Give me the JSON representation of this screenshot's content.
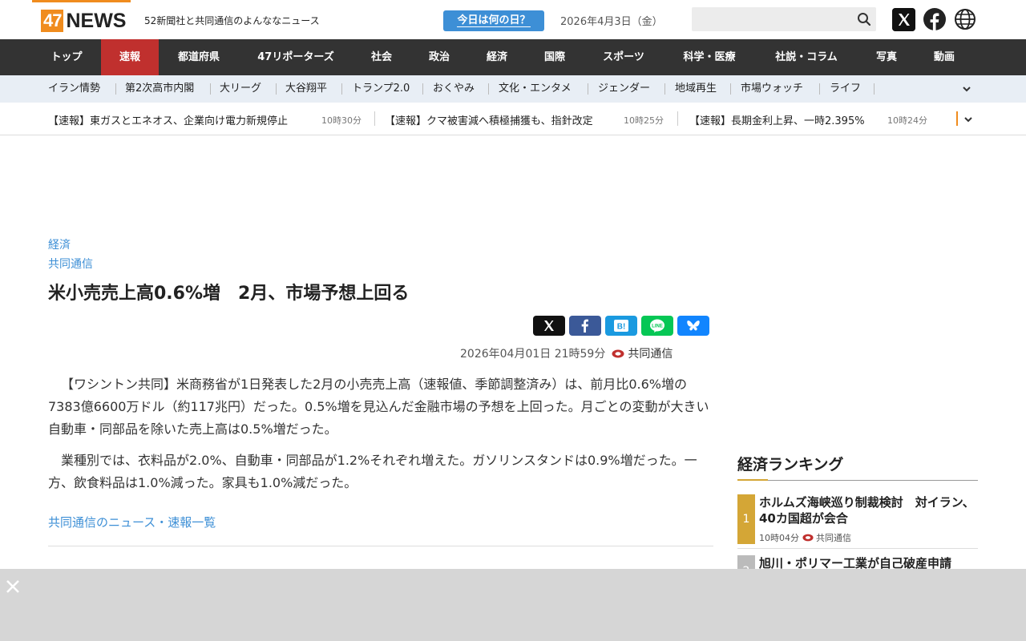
{
  "header": {
    "logo_num": "47",
    "logo_word": "NEWS",
    "tagline": "52新聞社と共同通信のよんななニュース",
    "today_button": "今日は何の日？",
    "date": "2026年4月3日（金）",
    "search_placeholder": ""
  },
  "mainnav": [
    {
      "label": "トップ",
      "w": 86
    },
    {
      "label": "速報",
      "w": 72,
      "active": true
    },
    {
      "label": "都道府県",
      "w": 100
    },
    {
      "label": "47リポーターズ",
      "w": 142
    },
    {
      "label": "社会",
      "w": 72
    },
    {
      "label": "政治",
      "w": 72
    },
    {
      "label": "経済",
      "w": 72
    },
    {
      "label": "国際",
      "w": 72
    },
    {
      "label": "スポーツ",
      "w": 100
    },
    {
      "label": "科学・医療",
      "w": 114
    },
    {
      "label": "社説・コラム",
      "w": 128
    },
    {
      "label": "写真",
      "w": 72
    },
    {
      "label": "動画",
      "w": 72
    }
  ],
  "subnav": [
    "イラン情勢",
    "第2次高市内閣",
    "大リーグ",
    "大谷翔平",
    "トランプ2.0",
    "おくやみ",
    "文化・エンタメ",
    "ジェンダー",
    "地域再生",
    "市場ウォッチ",
    "ライフ"
  ],
  "ticker": [
    {
      "text": "【速報】東ガスとエネオス、企業向け電力新規停止",
      "time": "10時30分"
    },
    {
      "text": "【速報】クマ被害減へ積極捕獲も、指針改定",
      "time": "10時25分"
    },
    {
      "text": "【速報】長期金利上昇、一時2.395%",
      "time": "10時24分"
    }
  ],
  "article": {
    "category": "経済",
    "source": "共同通信",
    "title": "米小売売上高0.6%増　2月、市場予想上回る",
    "datetime": "2026年04月01日 21時59分",
    "agency": "共同通信",
    "paragraphs": [
      "【ワシントン共同】米商務省が1日発表した2月の小売売上高（速報値、季節調整済み）は、前月比0.6%増の7383億6600万ドル（約117兆円）だった。0.5%増を見込んだ金融市場の予想を上回った。月ごとの変動が大きい自動車・同部品を除いた売上高は0.5%増だった。",
      "業種別では、衣料品が2.0%、自動車・同部品が1.2%それぞれ増えた。ガソリンスタンドは0.9%増だった。一方、飲食料品は1.0%減った。家具も1.0%減だった。"
    ],
    "more_link": "共同通信のニュース・速報一覧"
  },
  "ranking": {
    "title": "経済ランキング",
    "items": [
      {
        "rank": "1",
        "text": "ホルムズ海峡巡り制裁検討　対イラン、40カ国超が会合",
        "time": "10時04分",
        "agency": "共同通信"
      },
      {
        "rank": "2",
        "text": "旭川・ポリマー工業が自己破産申請"
      }
    ]
  },
  "colors": {
    "accent_blue": "#3d8fd6",
    "nav_dark": "#333333",
    "nav_active": "#c0302e",
    "logo_orange": "#f08c1e",
    "rank_gold": "#d4a636"
  }
}
